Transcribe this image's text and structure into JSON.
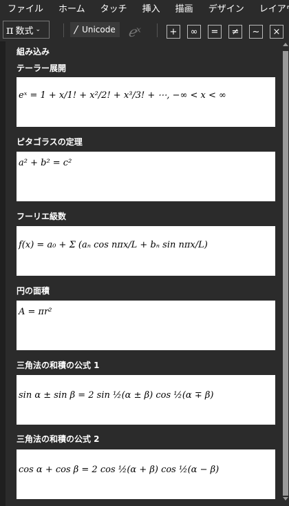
{
  "menu": [
    "ファイル",
    "ホーム",
    "タッチ",
    "挿入",
    "描画",
    "デザイン",
    "レイアウト"
  ],
  "toolbar": {
    "equation_label": "数式",
    "equation_icon": "π",
    "unicode_label": "Unicode",
    "symbols": [
      "+",
      "∞",
      "=",
      "≠",
      "~",
      "×"
    ]
  },
  "panel": {
    "section_title": "組み込み",
    "items": [
      {
        "title": "テーラー展開",
        "formula": "eˣ = 1 + x/1! + x²/2! + x³/3! + ⋯,    −∞ < x < ∞"
      },
      {
        "title": "ピタゴラスの定理",
        "formula": "a² + b² = c²"
      },
      {
        "title": "フーリエ級数",
        "formula": "f(x) = a₀ + Σ (aₙ cos nπx/L + bₙ sin nπx/L)"
      },
      {
        "title": "円の面積",
        "formula": "A = πr²"
      },
      {
        "title": "三角法の和積の公式 1",
        "formula": "sin α ± sin β = 2 sin ½(α ± β) cos ½(α ∓ β)"
      },
      {
        "title": "三角法の和積の公式 2",
        "formula": "cos α + cos β = 2 cos ½(α + β) cos ½(α − β)"
      }
    ]
  }
}
